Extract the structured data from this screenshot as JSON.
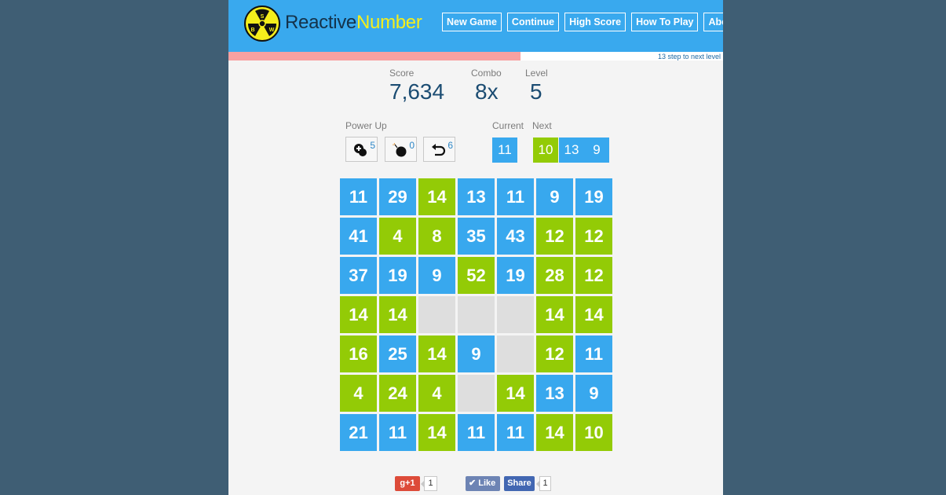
{
  "header": {
    "brand_part1": "Reactive",
    "brand_part2": "Number",
    "nav": [
      "New Game",
      "Continue",
      "High Score",
      "How To Play",
      "About"
    ]
  },
  "progress": {
    "fraction": 0.59,
    "text": "13 step to next level",
    "color": "#f7a1a1"
  },
  "stats": {
    "score_label": "Score",
    "score": "7,634",
    "combo_label": "Combo",
    "combo": "8x",
    "level_label": "Level",
    "level": "5"
  },
  "powerups": {
    "label": "Power Up",
    "items": [
      {
        "icon": "add-cell-icon",
        "count": "5"
      },
      {
        "icon": "bomb-icon",
        "count": "0"
      },
      {
        "icon": "undo-icon",
        "count": "6"
      }
    ]
  },
  "queue": {
    "current_label": "Current",
    "current": {
      "value": "11",
      "color": "blue"
    },
    "next_label": "Next",
    "next": [
      {
        "value": "10",
        "color": "green"
      },
      {
        "value": "13",
        "color": "blue"
      },
      {
        "value": "9",
        "color": "blue"
      }
    ]
  },
  "colors": {
    "blue": "#38a8ee",
    "green": "#93cb06",
    "empty": "#dedede",
    "header": "#39a9ee",
    "brand_accent": "#f5ee1c"
  },
  "board": [
    [
      {
        "v": "11",
        "c": "b"
      },
      {
        "v": "29",
        "c": "b"
      },
      {
        "v": "14",
        "c": "g"
      },
      {
        "v": "13",
        "c": "b"
      },
      {
        "v": "11",
        "c": "b"
      },
      {
        "v": "9",
        "c": "b"
      },
      {
        "v": "19",
        "c": "b"
      }
    ],
    [
      {
        "v": "41",
        "c": "b"
      },
      {
        "v": "4",
        "c": "g"
      },
      {
        "v": "8",
        "c": "g"
      },
      {
        "v": "35",
        "c": "b"
      },
      {
        "v": "43",
        "c": "b"
      },
      {
        "v": "12",
        "c": "g"
      },
      {
        "v": "12",
        "c": "g"
      }
    ],
    [
      {
        "v": "37",
        "c": "b"
      },
      {
        "v": "19",
        "c": "b"
      },
      {
        "v": "9",
        "c": "b"
      },
      {
        "v": "52",
        "c": "g"
      },
      {
        "v": "19",
        "c": "b"
      },
      {
        "v": "28",
        "c": "g"
      },
      {
        "v": "12",
        "c": "g"
      }
    ],
    [
      {
        "v": "14",
        "c": "g"
      },
      {
        "v": "14",
        "c": "g"
      },
      {
        "v": "",
        "c": "e"
      },
      {
        "v": "",
        "c": "e"
      },
      {
        "v": "",
        "c": "e"
      },
      {
        "v": "14",
        "c": "g"
      },
      {
        "v": "14",
        "c": "g"
      }
    ],
    [
      {
        "v": "16",
        "c": "g"
      },
      {
        "v": "25",
        "c": "b"
      },
      {
        "v": "14",
        "c": "g"
      },
      {
        "v": "9",
        "c": "b"
      },
      {
        "v": "",
        "c": "e"
      },
      {
        "v": "12",
        "c": "g"
      },
      {
        "v": "11",
        "c": "b"
      }
    ],
    [
      {
        "v": "4",
        "c": "g"
      },
      {
        "v": "24",
        "c": "g"
      },
      {
        "v": "4",
        "c": "g"
      },
      {
        "v": "",
        "c": "e"
      },
      {
        "v": "14",
        "c": "g"
      },
      {
        "v": "13",
        "c": "b"
      },
      {
        "v": "9",
        "c": "b"
      }
    ],
    [
      {
        "v": "21",
        "c": "b"
      },
      {
        "v": "11",
        "c": "b"
      },
      {
        "v": "14",
        "c": "g"
      },
      {
        "v": "11",
        "c": "b"
      },
      {
        "v": "11",
        "c": "b"
      },
      {
        "v": "14",
        "c": "g"
      },
      {
        "v": "10",
        "c": "g"
      }
    ]
  ],
  "social": {
    "gplus_label": "g+1",
    "gplus_count": "1",
    "like_label": "Like",
    "share_label": "Share",
    "share_count": "1"
  }
}
